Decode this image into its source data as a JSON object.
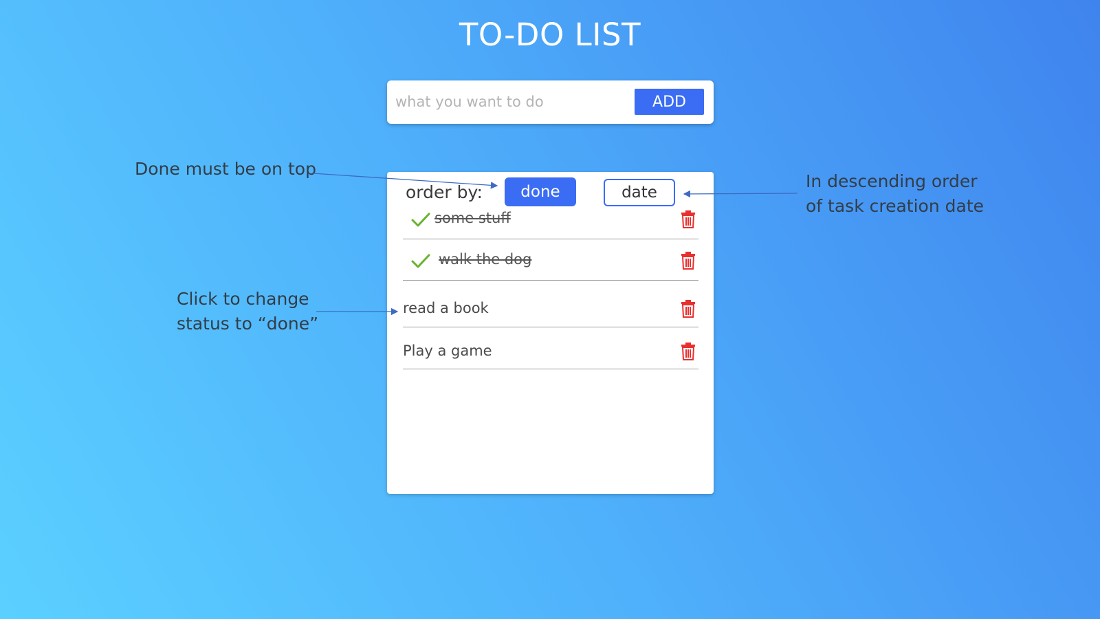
{
  "app": {
    "title": "TO-DO LIST"
  },
  "add_bar": {
    "placeholder": "what you want to do",
    "button_label": "ADD"
  },
  "sort": {
    "label": "order by:",
    "done_label": "done",
    "date_label": "date"
  },
  "tasks": [
    {
      "text": "some stuff",
      "done": true
    },
    {
      "text": "walk the dog",
      "done": true
    },
    {
      "text": "read a book",
      "done": false
    },
    {
      "text": "Play a game",
      "done": false
    }
  ],
  "annotations": {
    "done_top": "Done must be on top",
    "descending_1": "In descending order",
    "descending_2": "of task creation date",
    "click_1": "Click to change",
    "click_2": "status to “done”"
  },
  "colors": {
    "accent": "#3a6cf4",
    "check": "#6ab22e",
    "trash": "#e8312f",
    "arrow": "#3d6bc4"
  }
}
